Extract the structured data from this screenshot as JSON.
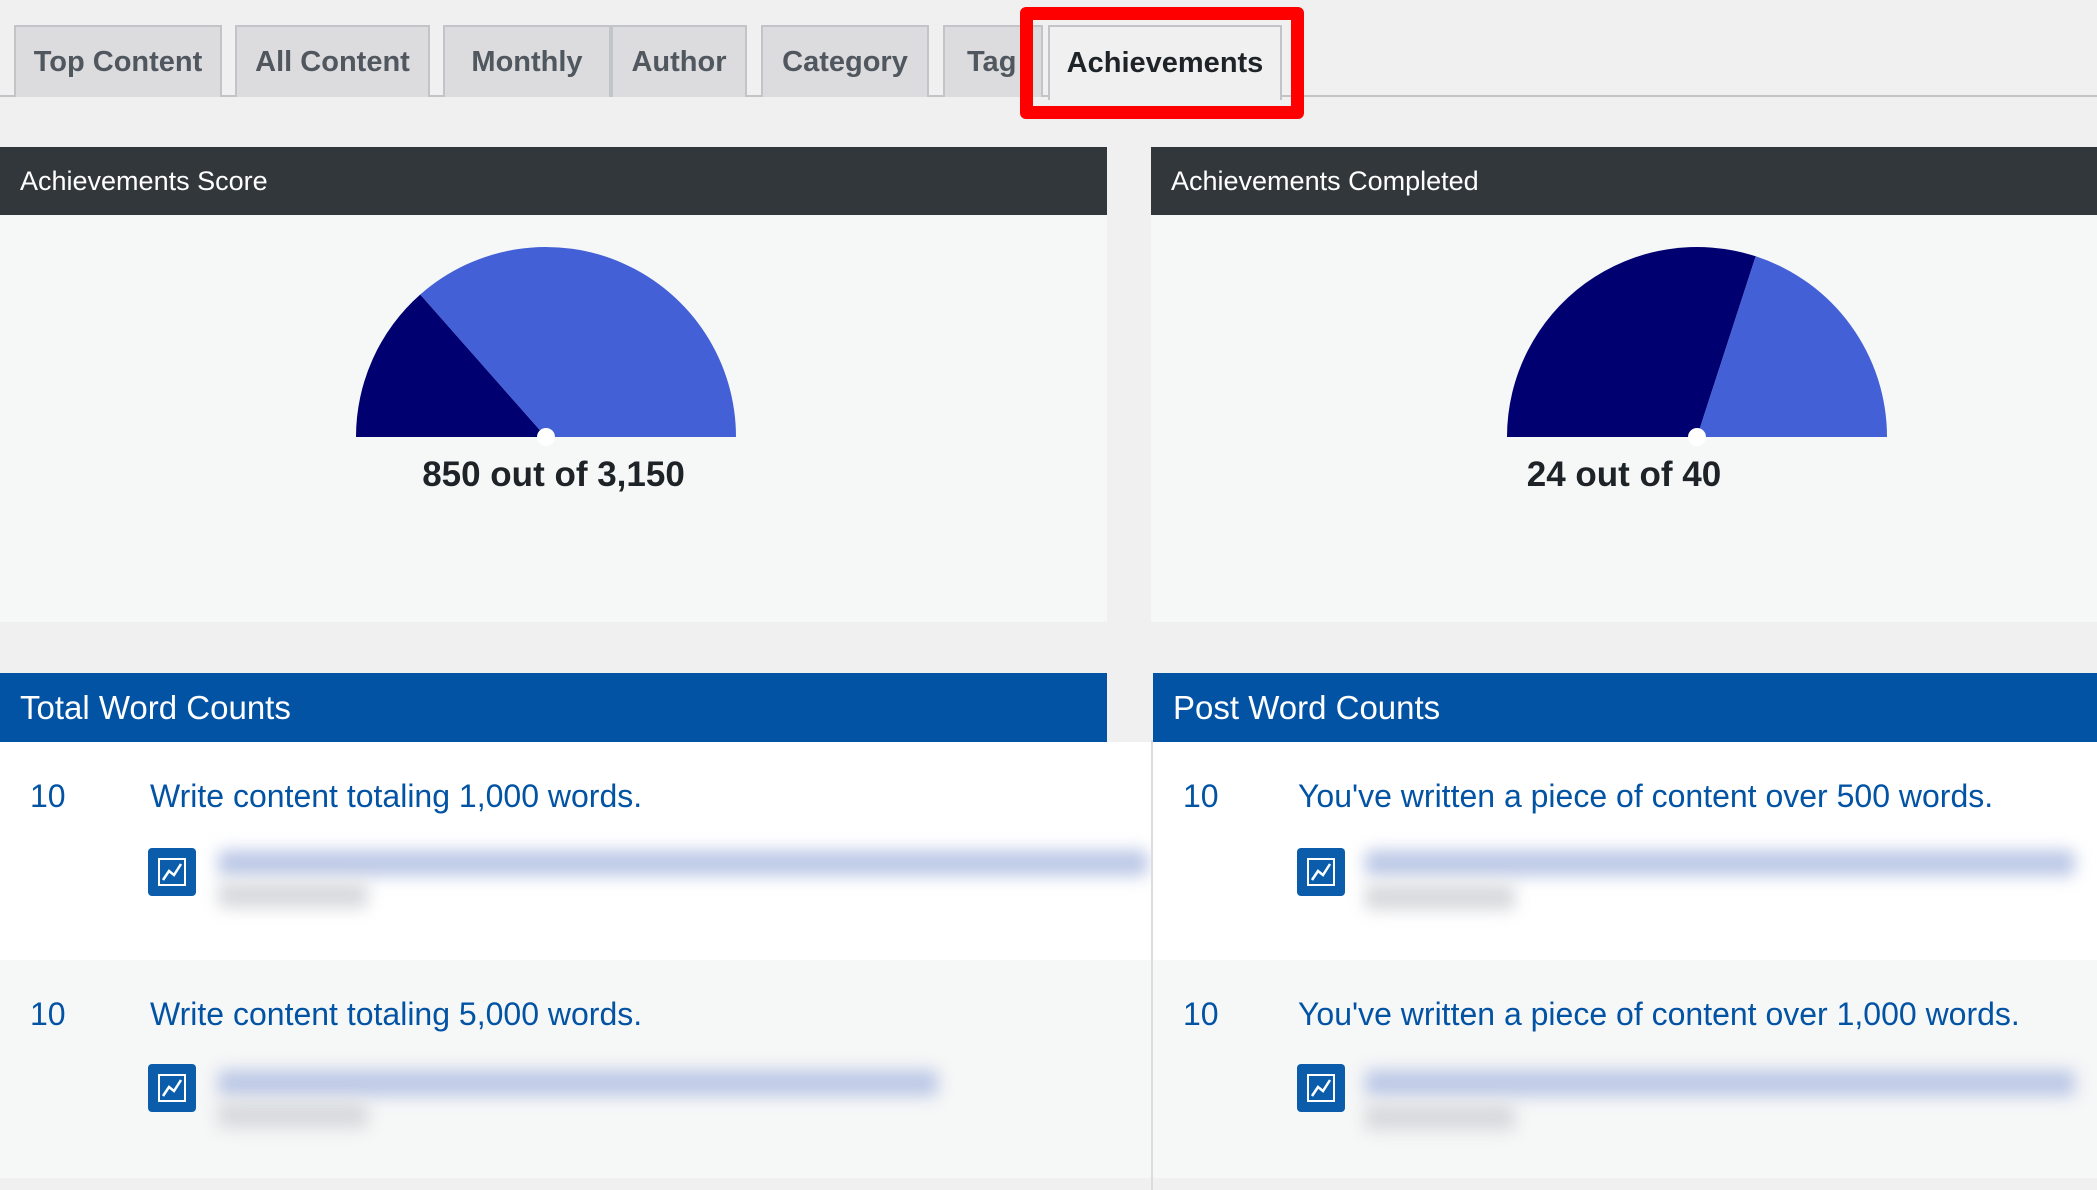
{
  "tabs": [
    {
      "label": "Top Content",
      "active": false
    },
    {
      "label": "All Content",
      "active": false
    },
    {
      "label": "Monthly",
      "active": false
    },
    {
      "label": "Author",
      "active": false
    },
    {
      "label": "Category",
      "active": false
    },
    {
      "label": "Tag",
      "active": false
    },
    {
      "label": "Achievements",
      "active": true
    }
  ],
  "colors": {
    "accent_blue": "#0353a4",
    "gauge_dark": "#000071",
    "gauge_light": "#4360d7",
    "header_dark": "#32373c",
    "highlight_red": "#ff0000"
  },
  "score_panel": {
    "title": "Achievements Score",
    "value": 850,
    "total": 3150,
    "label": "850 out of 3,150"
  },
  "completed_panel": {
    "title": "Achievements Completed",
    "value": 24,
    "total": 40,
    "label": "24 out of 40"
  },
  "total_word_counts": {
    "title": "Total Word Counts",
    "items": [
      {
        "score": "10",
        "text": "Write content totaling 1,000 words.",
        "icon": "chart-line-icon"
      },
      {
        "score": "10",
        "text": "Write content totaling 5,000 words.",
        "icon": "chart-line-icon"
      }
    ]
  },
  "post_word_counts": {
    "title": "Post Word Counts",
    "items": [
      {
        "score": "10",
        "text": "You've written a piece of content over 500 words.",
        "icon": "chart-line-icon"
      },
      {
        "score": "10",
        "text": "You've written a piece of content over 1,000 words.",
        "icon": "chart-line-icon"
      }
    ]
  }
}
